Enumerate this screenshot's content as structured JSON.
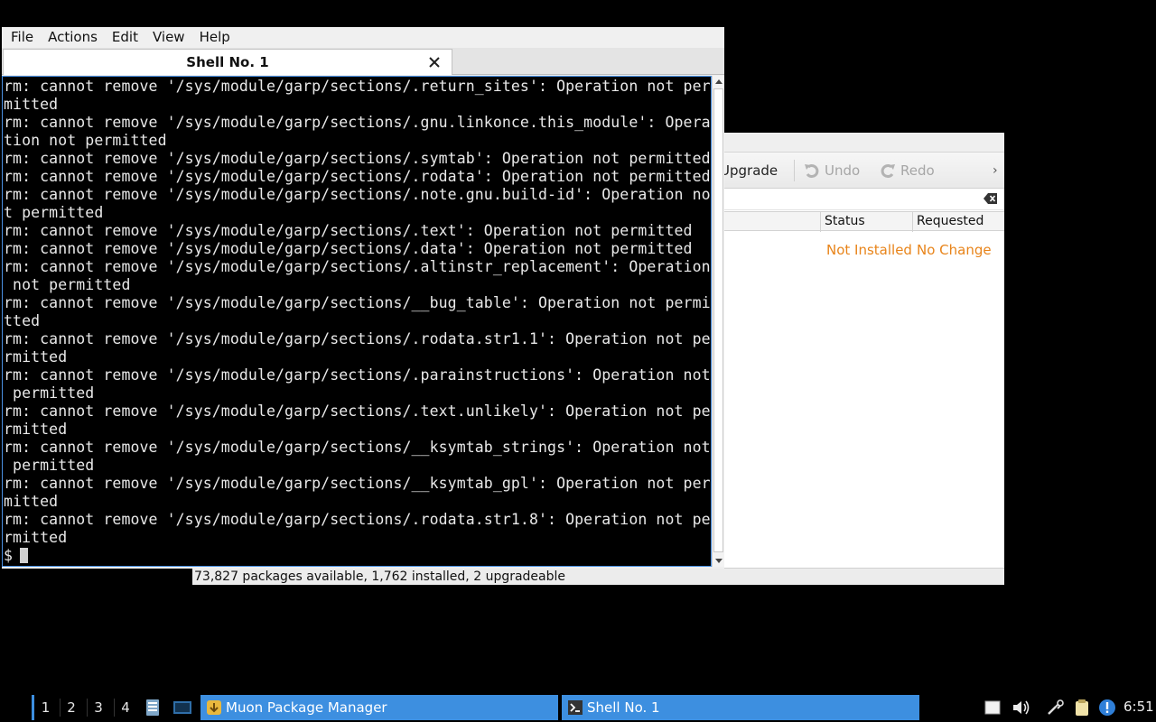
{
  "muon": {
    "toolbar": {
      "upgrade": "Upgrade",
      "undo": "Undo",
      "redo": "Redo",
      "more": "›"
    },
    "columns": {
      "status": "Status",
      "requested": "Requested"
    },
    "row": {
      "status": "Not Installed",
      "requested": "No Change"
    },
    "statusbar": "73,827 packages available, 1,762 installed, 2 upgradeable"
  },
  "terminal": {
    "menu": [
      "File",
      "Actions",
      "Edit",
      "View",
      "Help"
    ],
    "tab_title": "Shell No. 1",
    "lines": [
      "rm: cannot remove '/sys/module/garp/sections/.return_sites': Operation not per",
      "mitted",
      "rm: cannot remove '/sys/module/garp/sections/.gnu.linkonce.this_module': Opera",
      "tion not permitted",
      "rm: cannot remove '/sys/module/garp/sections/.symtab': Operation not permitted",
      "rm: cannot remove '/sys/module/garp/sections/.rodata': Operation not permitted",
      "rm: cannot remove '/sys/module/garp/sections/.note.gnu.build-id': Operation no",
      "t permitted",
      "rm: cannot remove '/sys/module/garp/sections/.text': Operation not permitted",
      "rm: cannot remove '/sys/module/garp/sections/.data': Operation not permitted",
      "rm: cannot remove '/sys/module/garp/sections/.altinstr_replacement': Operation",
      " not permitted",
      "rm: cannot remove '/sys/module/garp/sections/__bug_table': Operation not permi",
      "tted",
      "rm: cannot remove '/sys/module/garp/sections/.rodata.str1.1': Operation not pe",
      "rmitted",
      "rm: cannot remove '/sys/module/garp/sections/.parainstructions': Operation not",
      " permitted",
      "rm: cannot remove '/sys/module/garp/sections/.text.unlikely': Operation not pe",
      "rmitted",
      "rm: cannot remove '/sys/module/garp/sections/__ksymtab_strings': Operation not",
      " permitted",
      "rm: cannot remove '/sys/module/garp/sections/__ksymtab_gpl': Operation not per",
      "mitted",
      "rm: cannot remove '/sys/module/garp/sections/.rodata.str1.8': Operation not pe",
      "rmitted"
    ],
    "prompt": "$"
  },
  "taskbar": {
    "desktops": [
      "1",
      "2",
      "3",
      "4"
    ],
    "tasks": {
      "muon": "Muon Package Manager",
      "shell": "Shell No. 1"
    },
    "clock": "6:51"
  },
  "colors": {
    "accent": "#3d8fe0",
    "status_orange": "#e8841a",
    "terminal_bg": "#000000"
  },
  "icons": [
    "redo-icon",
    "undo-icon",
    "clear-text-icon",
    "close-icon",
    "scroll-up-icon",
    "scroll-down-icon",
    "file-manager-icon",
    "terminal-launcher-icon",
    "muon-app-icon",
    "terminal-app-icon",
    "notes-icon",
    "volume-icon",
    "network-icon",
    "clipboard-icon",
    "update-notifier-icon"
  ]
}
